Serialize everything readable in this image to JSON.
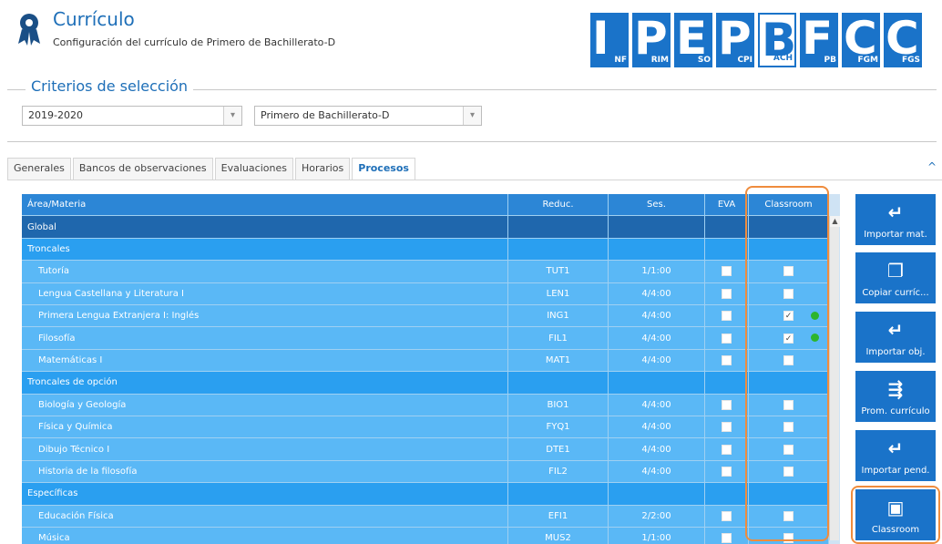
{
  "header": {
    "title": "Currículo",
    "subtitle": "Configuración del currículo de Primero de Bachillerato-D",
    "modules": [
      {
        "letter": "I",
        "label": "NF",
        "active": false
      },
      {
        "letter": "P",
        "label": "RIM",
        "active": false
      },
      {
        "letter": "E",
        "label": "SO",
        "active": false
      },
      {
        "letter": "P",
        "label": "CPI",
        "active": false
      },
      {
        "letter": "B",
        "label": "ACH",
        "active": true
      },
      {
        "letter": "F",
        "label": "PB",
        "active": false
      },
      {
        "letter": "C",
        "label": "FGM",
        "active": false
      },
      {
        "letter": "C",
        "label": "FGS",
        "active": false
      }
    ]
  },
  "criterios": {
    "legend": "Criterios de selección",
    "year": "2019-2020",
    "group": "Primero de Bachillerato-D"
  },
  "tabs": [
    "Generales",
    "Bancos de observaciones",
    "Evaluaciones",
    "Horarios",
    "Procesos"
  ],
  "active_tab": "Procesos",
  "grid": {
    "columns": [
      "Área/Materia",
      "Reduc.",
      "Ses.",
      "EVA",
      "Classroom"
    ],
    "rows": [
      {
        "type": "global",
        "area": "Global"
      },
      {
        "type": "group",
        "area": "Troncales"
      },
      {
        "type": "item",
        "area": "Tutoría",
        "reduc": "TUT1",
        "ses": "1/1:00",
        "eva": false,
        "classroom": false,
        "dot": false
      },
      {
        "type": "item",
        "area": "Lengua Castellana y Literatura I",
        "reduc": "LEN1",
        "ses": "4/4:00",
        "eva": false,
        "classroom": false,
        "dot": false
      },
      {
        "type": "item",
        "area": "Primera Lengua Extranjera I: Inglés",
        "reduc": "ING1",
        "ses": "4/4:00",
        "eva": false,
        "classroom": true,
        "dot": true
      },
      {
        "type": "item",
        "area": "Filosofía",
        "reduc": "FIL1",
        "ses": "4/4:00",
        "eva": false,
        "classroom": true,
        "dot": true
      },
      {
        "type": "item",
        "area": "Matemáticas I",
        "reduc": "MAT1",
        "ses": "4/4:00",
        "eva": false,
        "classroom": false,
        "dot": false
      },
      {
        "type": "group",
        "area": "Troncales de opción"
      },
      {
        "type": "item",
        "area": "Biología y Geología",
        "reduc": "BIO1",
        "ses": "4/4:00",
        "eva": false,
        "classroom": false,
        "dot": false
      },
      {
        "type": "item",
        "area": "Física y Química",
        "reduc": "FYQ1",
        "ses": "4/4:00",
        "eva": false,
        "classroom": false,
        "dot": false
      },
      {
        "type": "item",
        "area": "Dibujo Técnico I",
        "reduc": "DTE1",
        "ses": "4/4:00",
        "eva": false,
        "classroom": false,
        "dot": false
      },
      {
        "type": "item",
        "area": "Historia de la filosofía",
        "reduc": "FIL2",
        "ses": "4/4:00",
        "eva": false,
        "classroom": false,
        "dot": false
      },
      {
        "type": "group",
        "area": "Específicas"
      },
      {
        "type": "item",
        "area": "Educación Física",
        "reduc": "EFI1",
        "ses": "2/2:00",
        "eva": false,
        "classroom": false,
        "dot": false
      },
      {
        "type": "item",
        "area": "Música",
        "reduc": "MUS2",
        "ses": "1/1:00",
        "eva": false,
        "classroom": false,
        "dot": false
      }
    ]
  },
  "actions": [
    {
      "label": "Importar mat.",
      "icon": "import-icon",
      "glyph": "↵"
    },
    {
      "label": "Copiar curríc...",
      "icon": "copy-icon",
      "glyph": "❐"
    },
    {
      "label": "Importar obj.",
      "icon": "import-icon",
      "glyph": "↵"
    },
    {
      "label": "Prom. currículo",
      "icon": "promote-icon",
      "glyph": "⇶"
    },
    {
      "label": "Importar pend.",
      "icon": "import-icon",
      "glyph": "↵"
    },
    {
      "label": "Classroom",
      "icon": "classroom-icon",
      "glyph": "▣"
    }
  ],
  "colors": {
    "accent": "#1a73c9",
    "highlight": "#ef8c3d",
    "status_ok": "#2db52d"
  }
}
